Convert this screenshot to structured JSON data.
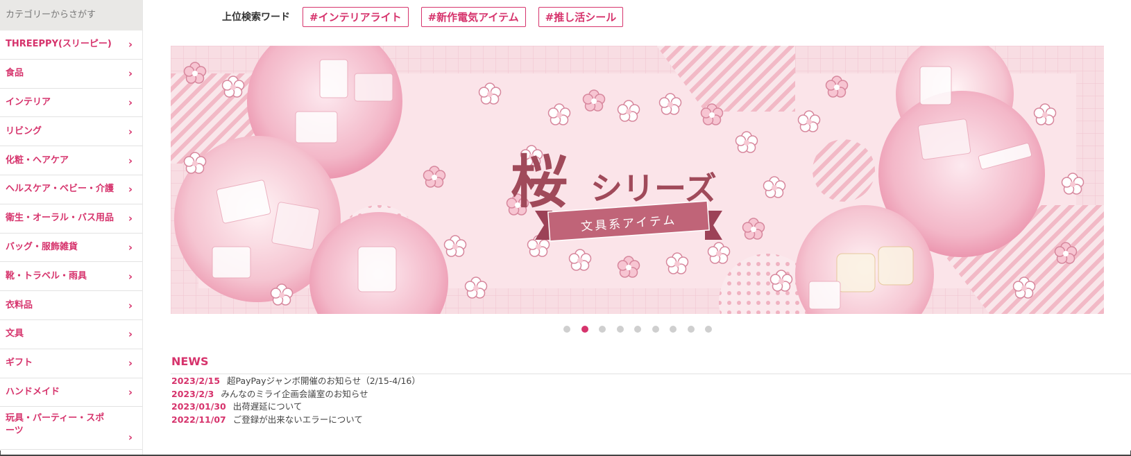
{
  "sidebar": {
    "header": "カテゴリーからさがす",
    "items": [
      {
        "label": "THREEPPY(スリーピー)"
      },
      {
        "label": "食品"
      },
      {
        "label": "インテリア"
      },
      {
        "label": "リビング"
      },
      {
        "label": "化粧・ヘアケア"
      },
      {
        "label": "ヘルスケア・ベビー・介護"
      },
      {
        "label": "衛生・オーラル・バス用品"
      },
      {
        "label": "バッグ・服飾雑貨"
      },
      {
        "label": "靴・トラベル・雨具"
      },
      {
        "label": "衣料品"
      },
      {
        "label": "文具"
      },
      {
        "label": "ギフト"
      },
      {
        "label": "ハンドメイド"
      },
      {
        "label": "玩具・パーティー・スポーツ"
      }
    ],
    "chevron": "›",
    "chevron_icon": "chevron-right-icon"
  },
  "top_search": {
    "label": "上位検索ワード",
    "tags": [
      "#インテリアライト",
      "#新作電気アイテム",
      "#推し活シール"
    ]
  },
  "banner": {
    "title_kanji": "桜",
    "title_kana": "シリーズ",
    "ribbon": "文具系アイテム",
    "colors": {
      "pink": "#d6336c",
      "bg": "#f6d6dd",
      "dark": "#a04a5a"
    }
  },
  "carousel": {
    "count": 9,
    "active_index": 1
  },
  "news": {
    "title": "NEWS",
    "items": [
      {
        "date": "2023/2/15",
        "text": "超PayPayジャンボ開催のお知らせ（2/15-4/16）"
      },
      {
        "date": "2023/2/3",
        "text": "みんなのミライ企画会議室のお知らせ"
      },
      {
        "date": "2023/01/30",
        "text": "出荷遅延について"
      },
      {
        "date": "2022/11/07",
        "text": "ご登録が出来ないエラーについて"
      }
    ]
  }
}
